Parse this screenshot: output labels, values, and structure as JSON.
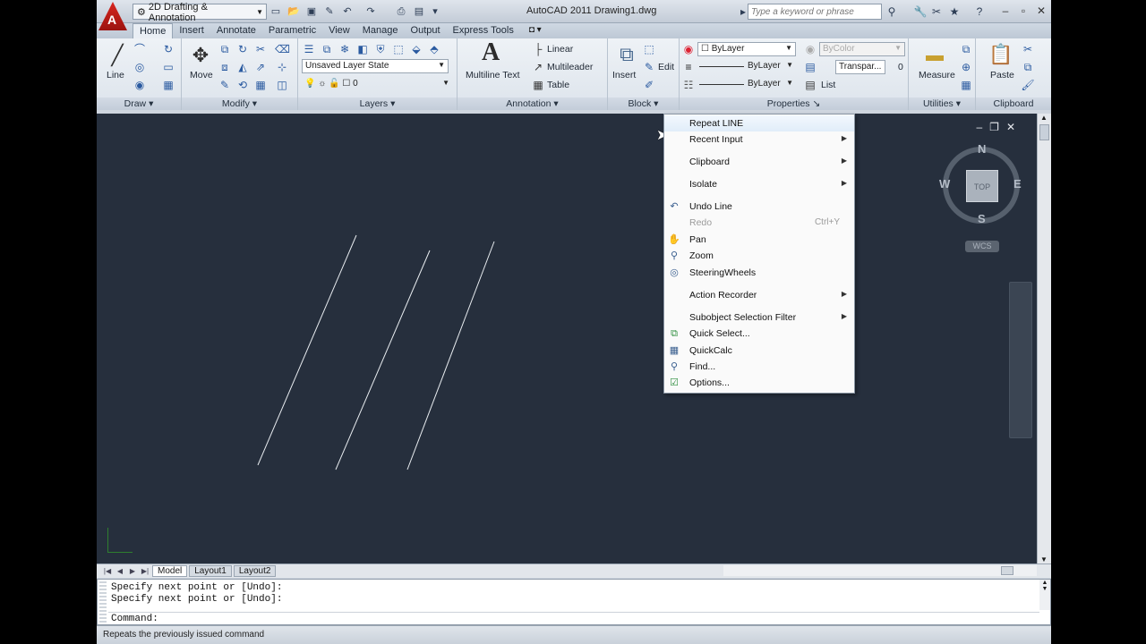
{
  "title_bar": {
    "workspace": "2D Drafting & Annotation",
    "title": "AutoCAD 2011    Drawing1.dwg",
    "search_placeholder": "Type a keyword or phrase"
  },
  "tabs": [
    "Home",
    "Insert",
    "Annotate",
    "Parametric",
    "View",
    "Manage",
    "Output",
    "Express Tools"
  ],
  "ribbon": {
    "draw": {
      "title": "Draw",
      "line_label": "Line"
    },
    "modify": {
      "title": "Modify",
      "move_label": "Move"
    },
    "layers": {
      "title": "Layers",
      "layer_state": "Unsaved Layer State",
      "layer_value": "0"
    },
    "annotation": {
      "title": "Annotation",
      "mtext_label": "Multiline Text",
      "linear": "Linear",
      "multileader": "Multileader",
      "table": "Table"
    },
    "block": {
      "title": "Block",
      "insert": "Insert",
      "edit": "Edit"
    },
    "properties": {
      "title": "Properties",
      "color": "ByLayer",
      "lineweight": "ByLayer",
      "linetype": "ByLayer",
      "plotstyle": "ByColor",
      "transparency": "Transpar...",
      "transparency_value": "0",
      "list": "List"
    },
    "utilities": {
      "title": "Utilities",
      "measure": "Measure"
    },
    "clipboard": {
      "title": "Clipboard",
      "paste": "Paste"
    }
  },
  "viewcube": {
    "north": "N",
    "south": "S",
    "east": "E",
    "west": "W",
    "face": "TOP",
    "ucs": "WCS"
  },
  "context_menu": [
    {
      "label": "Repeat LINE",
      "highlighted": true
    },
    {
      "label": "Recent Input",
      "submenu": true
    },
    {
      "label": "Clipboard",
      "submenu": true
    },
    {
      "label": "Isolate",
      "submenu": true
    },
    {
      "label": "Undo Line",
      "icon": "undo-icon"
    },
    {
      "label": "Redo",
      "shortcut": "Ctrl+Y",
      "disabled": true
    },
    {
      "label": "Pan",
      "icon": "pan-icon"
    },
    {
      "label": "Zoom",
      "icon": "zoom-icon"
    },
    {
      "label": "SteeringWheels",
      "icon": "steeringwheels-icon"
    },
    {
      "label": "Action Recorder",
      "submenu": true
    },
    {
      "label": "Subobject Selection Filter",
      "submenu": true
    },
    {
      "label": "Quick Select...",
      "icon": "quick-select-icon"
    },
    {
      "label": "QuickCalc",
      "icon": "calculator-icon"
    },
    {
      "label": "Find...",
      "icon": "find-icon"
    },
    {
      "label": "Options...",
      "icon": "options-icon"
    }
  ],
  "layout_tabs": [
    "Model",
    "Layout1",
    "Layout2"
  ],
  "command": {
    "history": [
      "Specify next point or [Undo]:",
      "Specify next point or [Undo]:"
    ],
    "prompt": "Command:"
  },
  "status_text": "Repeats the previously issued command"
}
